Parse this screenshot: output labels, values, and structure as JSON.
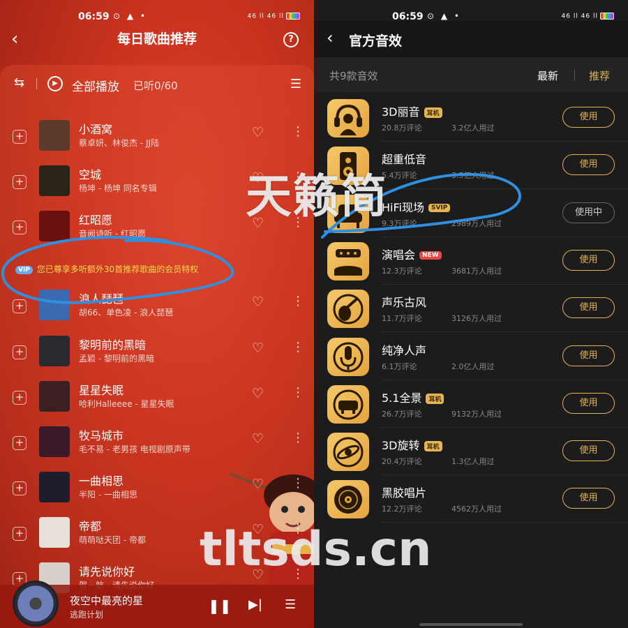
{
  "status_bar": {
    "left_time": "06:59",
    "right_time": "06:59",
    "network": "46 ll 46 ll"
  },
  "left": {
    "header_title": "每日歌曲推荐",
    "play_all_label": "全部播放",
    "listened_count": "已听0/60",
    "vip_badge": "VIP",
    "vip_notice": "您已尊享多听额外30首推荐歌曲的会员特权",
    "songs_top": [
      {
        "name": "小酒窝",
        "meta": "蔡卓妍、林俊杰 - JJ陆",
        "cover": "#5a3a2a"
      },
      {
        "name": "空城",
        "meta": "杨坤 - 杨坤 同名专辑",
        "cover": "#2a2418"
      },
      {
        "name": "红昭愿",
        "meta": "音阙诗听 - 红昭愿",
        "cover": "#6a1010"
      }
    ],
    "songs_bottom": [
      {
        "name": "浪人琵琶",
        "meta": "胡66、单色凌 - 浪人琵琶",
        "cover": "#3a6ab0"
      },
      {
        "name": "黎明前的黑暗",
        "meta": "孟颖 - 黎明前的黑暗",
        "cover": "#2a2a2e"
      },
      {
        "name": "星星失眠",
        "meta": "哈利Halleeee - 星星失眠",
        "cover": "#3a2020"
      },
      {
        "name": "牧马城市",
        "meta": "毛不易 - 老男孩 电视剧原声带",
        "cover": "#3a1a2a"
      },
      {
        "name": "一曲相思",
        "meta": "半阳 - 一曲相思",
        "cover": "#1e1e2a"
      },
      {
        "name": "帝都",
        "meta": "萌萌哒天团 - 帝都",
        "cover": "#e8e0d8"
      },
      {
        "name": "请先说你好",
        "meta": "贺一航 - 请先说你好",
        "cover": "#d8d0c8"
      }
    ],
    "player": {
      "title": "夜空中最亮的星",
      "artist": "逃跑计划"
    }
  },
  "right": {
    "header_title": "官方音效",
    "total": "共9款音效",
    "sort_latest": "最新",
    "sort_recommend": "推荐",
    "use_label": "使用",
    "in_use_label": "使用中",
    "effects": [
      {
        "name": "3D丽音",
        "tag": "耳机",
        "tag_type": "earphone",
        "comments": "20.8万评论",
        "users": "3.2亿人用过",
        "icon": "headphones-person-icon",
        "in_use": false
      },
      {
        "name": "超重低音",
        "tag": "",
        "tag_type": "",
        "comments": "5.4万评论",
        "users": "3.5亿人用过",
        "icon": "speaker-icon",
        "in_use": false
      },
      {
        "name": "HiFi现场",
        "tag": "SVIP",
        "tag_type": "svip",
        "comments": "9.3万评论",
        "users": "2989万人用过",
        "icon": "armchair-icon",
        "in_use": true
      },
      {
        "name": "演唱会",
        "tag": "NEW",
        "tag_type": "new",
        "comments": "12.3万评论",
        "users": "3681万人用过",
        "icon": "stage-icon",
        "in_use": false
      },
      {
        "name": "声乐古风",
        "tag": "",
        "tag_type": "",
        "comments": "11.7万评论",
        "users": "3126万人用过",
        "icon": "pipa-icon",
        "in_use": false
      },
      {
        "name": "纯净人声",
        "tag": "",
        "tag_type": "",
        "comments": "6.1万评论",
        "users": "2.0亿人用过",
        "icon": "microphone-icon",
        "in_use": false
      },
      {
        "name": "5.1全景",
        "tag": "耳机",
        "tag_type": "earphone",
        "comments": "26.7万评论",
        "users": "9132万人用过",
        "icon": "sofa-surround-icon",
        "in_use": false
      },
      {
        "name": "3D旋转",
        "tag": "耳机",
        "tag_type": "earphone",
        "comments": "20.4万评论",
        "users": "1.3亿人用过",
        "icon": "orbit-icon",
        "in_use": false
      },
      {
        "name": "黑胶唱片",
        "tag": "",
        "tag_type": "",
        "comments": "12.2万评论",
        "users": "4562万人用过",
        "icon": "vinyl-icon",
        "in_use": false
      }
    ]
  },
  "watermark": {
    "brand": "天籁简",
    "url": "tltsds.cn"
  },
  "colors": {
    "accent_gold": "#e5b454",
    "left_bg": "#c8321f",
    "right_bg": "#1c1c1c",
    "scribble": "#2f8fe0"
  }
}
